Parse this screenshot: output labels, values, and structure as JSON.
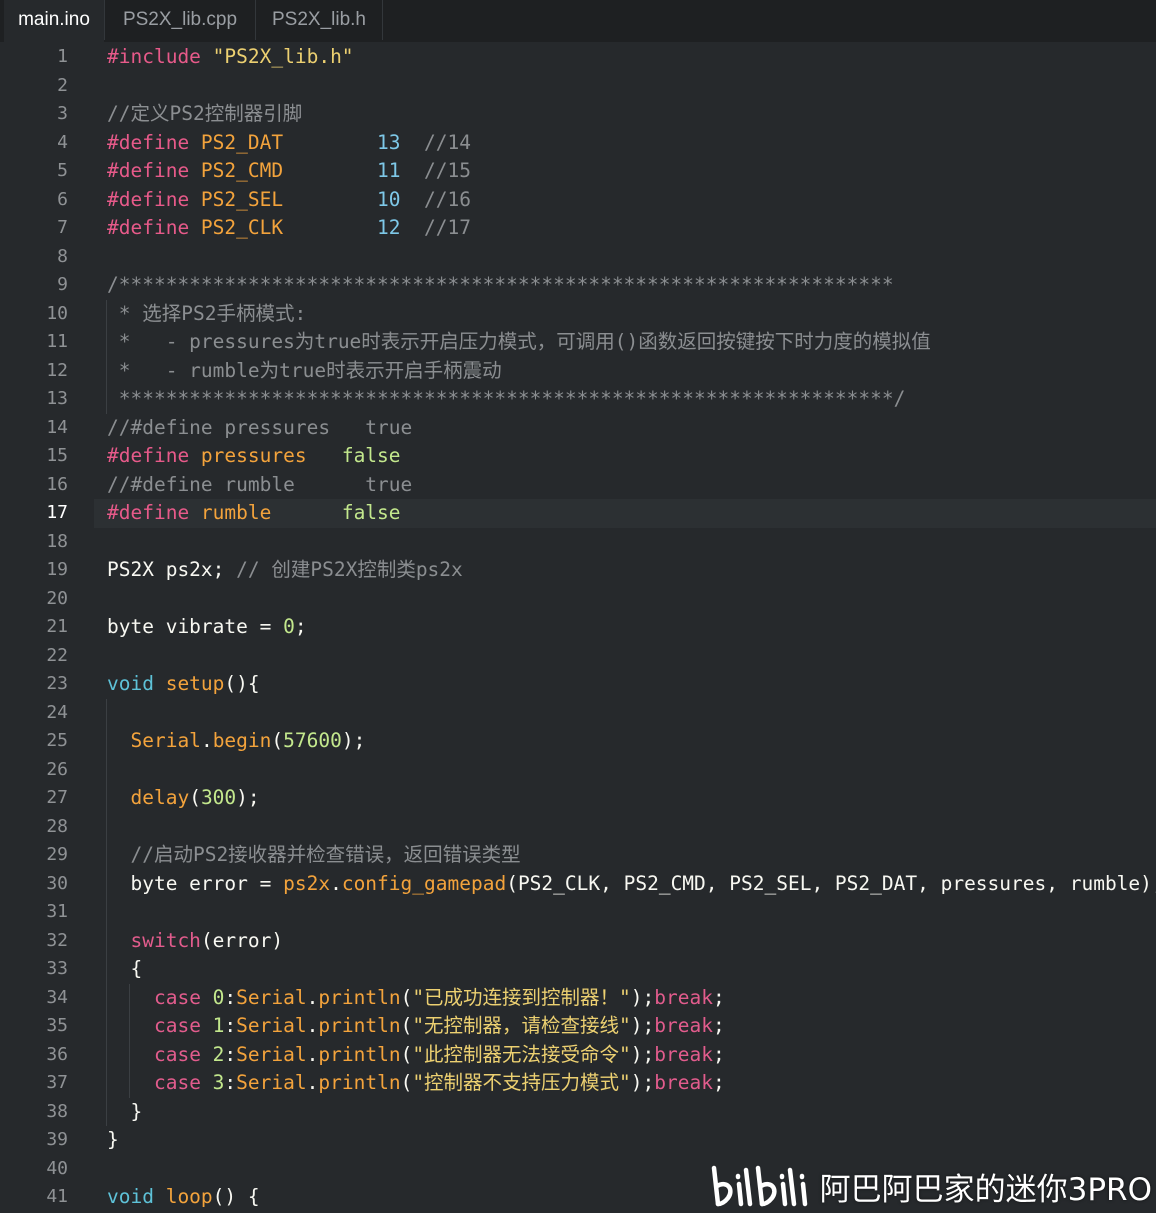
{
  "tabs": [
    {
      "label": "main.ino",
      "active": true
    },
    {
      "label": "PS2X_lib.cpp",
      "active": false
    },
    {
      "label": "PS2X_lib.h",
      "active": false
    }
  ],
  "current_line": 17,
  "lines": [
    [
      [
        "pp",
        "#include "
      ],
      [
        "str",
        "\"PS2X_lib.h\""
      ]
    ],
    [],
    [
      [
        "cm",
        "//定义PS2控制器引脚"
      ]
    ],
    [
      [
        "pp",
        "#define "
      ],
      [
        "mac",
        "PS2_DAT"
      ],
      [
        "",
        "        "
      ],
      [
        "nbl",
        "13"
      ],
      [
        "",
        "  "
      ],
      [
        "cm",
        "//14"
      ]
    ],
    [
      [
        "pp",
        "#define "
      ],
      [
        "mac",
        "PS2_CMD"
      ],
      [
        "",
        "        "
      ],
      [
        "nbl",
        "11"
      ],
      [
        "",
        "  "
      ],
      [
        "cm",
        "//15"
      ]
    ],
    [
      [
        "pp",
        "#define "
      ],
      [
        "mac",
        "PS2_SEL"
      ],
      [
        "",
        "        "
      ],
      [
        "nbl",
        "10"
      ],
      [
        "",
        "  "
      ],
      [
        "cm",
        "//16"
      ]
    ],
    [
      [
        "pp",
        "#define "
      ],
      [
        "mac",
        "PS2_CLK"
      ],
      [
        "",
        "        "
      ],
      [
        "nbl",
        "12"
      ],
      [
        "",
        "  "
      ],
      [
        "cm",
        "//17"
      ]
    ],
    [],
    [
      [
        "cm",
        "/******************************************************************"
      ]
    ],
    [
      [
        "cm",
        " * 选择PS2手柄模式:"
      ]
    ],
    [
      [
        "cm",
        " *   - pressures为true时表示开启压力模式，可调用()函数返回按键按下时力度的模拟值"
      ]
    ],
    [
      [
        "cm",
        " *   - rumble为true时表示开启手柄震动"
      ]
    ],
    [
      [
        "cm",
        " ******************************************************************/"
      ]
    ],
    [
      [
        "cm",
        "//#define pressures   true"
      ]
    ],
    [
      [
        "pp",
        "#define "
      ],
      [
        "mac",
        "pressures"
      ],
      [
        "",
        "   "
      ],
      [
        "bool",
        "false"
      ]
    ],
    [
      [
        "cm",
        "//#define rumble      true"
      ]
    ],
    [
      [
        "pp",
        "#define "
      ],
      [
        "mac",
        "rumble"
      ],
      [
        "",
        "      "
      ],
      [
        "bool",
        "false"
      ]
    ],
    [],
    [
      [
        "",
        "PS2X ps2x; "
      ],
      [
        "cm",
        "// 创建PS2X控制类ps2x"
      ]
    ],
    [],
    [
      [
        "",
        "byte vibrate = "
      ],
      [
        "num",
        "0"
      ],
      [
        "",
        ";"
      ]
    ],
    [],
    [
      [
        "kwv",
        "void "
      ],
      [
        "fn",
        "setup"
      ],
      [
        "",
        "(){"
      ]
    ],
    [],
    [
      [
        "",
        "  "
      ],
      [
        "obj",
        "Serial"
      ],
      [
        "",
        "."
      ],
      [
        "fn",
        "begin"
      ],
      [
        "",
        "("
      ],
      [
        "num",
        "57600"
      ],
      [
        "",
        ");"
      ]
    ],
    [],
    [
      [
        "",
        "  "
      ],
      [
        "fn",
        "delay"
      ],
      [
        "",
        "("
      ],
      [
        "num",
        "300"
      ],
      [
        "",
        ");"
      ]
    ],
    [],
    [
      [
        "",
        "  "
      ],
      [
        "cm",
        "//启动PS2接收器并检查错误，返回错误类型"
      ]
    ],
    [
      [
        "",
        "  byte error = "
      ],
      [
        "obj",
        "ps2x"
      ],
      [
        "",
        "."
      ],
      [
        "fn",
        "config_gamepad"
      ],
      [
        "",
        "(PS2_CLK, PS2_CMD, PS2_SEL, PS2_DAT, pressures, rumble);"
      ]
    ],
    [],
    [
      [
        "",
        "  "
      ],
      [
        "kw",
        "switch"
      ],
      [
        "",
        "(error)"
      ]
    ],
    [
      [
        "",
        "  {"
      ]
    ],
    [
      [
        "",
        "    "
      ],
      [
        "kw",
        "case "
      ],
      [
        "num",
        "0"
      ],
      [
        "",
        ":"
      ],
      [
        "obj",
        "Serial"
      ],
      [
        "",
        "."
      ],
      [
        "fn",
        "println"
      ],
      [
        "",
        "("
      ],
      [
        "str",
        "\"已成功连接到控制器！\""
      ],
      [
        "",
        ");"
      ],
      [
        "kw",
        "break"
      ],
      [
        "",
        ";"
      ]
    ],
    [
      [
        "",
        "    "
      ],
      [
        "kw",
        "case "
      ],
      [
        "num",
        "1"
      ],
      [
        "",
        ":"
      ],
      [
        "obj",
        "Serial"
      ],
      [
        "",
        "."
      ],
      [
        "fn",
        "println"
      ],
      [
        "",
        "("
      ],
      [
        "str",
        "\"无控制器，请检查接线\""
      ],
      [
        "",
        ");"
      ],
      [
        "kw",
        "break"
      ],
      [
        "",
        ";"
      ]
    ],
    [
      [
        "",
        "    "
      ],
      [
        "kw",
        "case "
      ],
      [
        "num",
        "2"
      ],
      [
        "",
        ":"
      ],
      [
        "obj",
        "Serial"
      ],
      [
        "",
        "."
      ],
      [
        "fn",
        "println"
      ],
      [
        "",
        "("
      ],
      [
        "str",
        "\"此控制器无法接受命令\""
      ],
      [
        "",
        ");"
      ],
      [
        "kw",
        "break"
      ],
      [
        "",
        ";"
      ]
    ],
    [
      [
        "",
        "    "
      ],
      [
        "kw",
        "case "
      ],
      [
        "num",
        "3"
      ],
      [
        "",
        ":"
      ],
      [
        "obj",
        "Serial"
      ],
      [
        "",
        "."
      ],
      [
        "fn",
        "println"
      ],
      [
        "",
        "("
      ],
      [
        "str",
        "\"控制器不支持压力模式\""
      ],
      [
        "",
        ");"
      ],
      [
        "kw",
        "break"
      ],
      [
        "",
        ";"
      ]
    ],
    [
      [
        "",
        "  }"
      ]
    ],
    [
      [
        "",
        "}"
      ]
    ],
    [],
    [
      [
        "kwv",
        "void "
      ],
      [
        "fn",
        "loop"
      ],
      [
        "",
        "() {"
      ]
    ]
  ],
  "watermark": {
    "text": "阿巴阿巴家的迷你3PRO",
    "logo_icon": "bilibili-logo-icon"
  }
}
